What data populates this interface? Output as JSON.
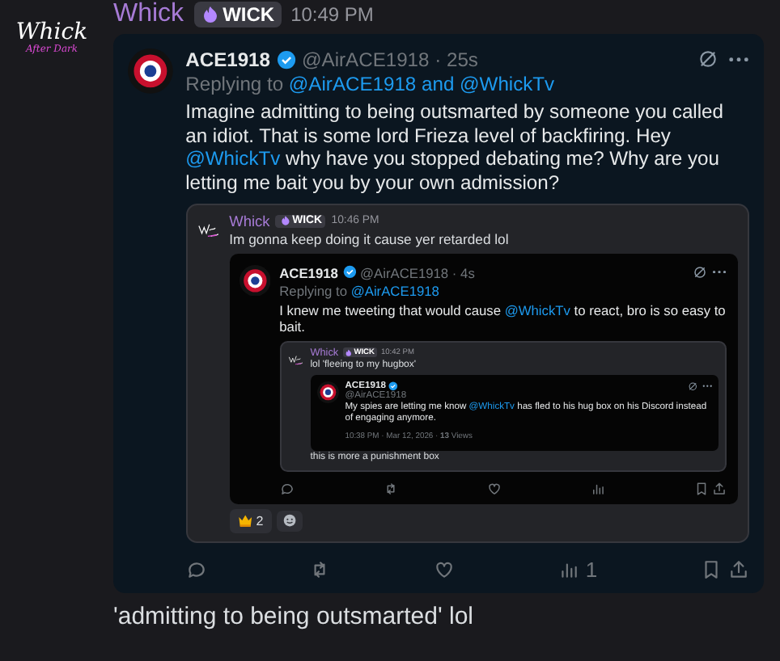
{
  "message": {
    "author": "Whick",
    "badge": "WICK",
    "time": "10:49 PM",
    "avatar_text": [
      "Whick",
      "After Dark"
    ],
    "tweet": {
      "name": "ACE1918",
      "handle": "@AirACE1918",
      "time": "· 25s",
      "has_actions": true,
      "views": "1",
      "replying": [
        {
          "text": "Replying to",
          "kind": "plain"
        },
        {
          "text": "@AirACE1918",
          "kind": "mention"
        },
        {
          "text": "and",
          "kind": "mention"
        },
        {
          "text": "@WhickTv",
          "kind": "mention"
        }
      ],
      "body": [
        {
          "text": "Imagine admitting to being outsmarted by someone you called an idiot. That is some lord Frieza level of backfiring. Hey ",
          "kind": "plain"
        },
        {
          "text": "@WhickTv",
          "kind": "mention"
        },
        {
          "text": " why have you stopped debating me?  Why are you letting me bait you by your own admission?",
          "kind": "plain"
        }
      ],
      "quote": {
        "author": "Whick",
        "badge": "WICK",
        "time": "10:46 PM",
        "text": "Im gonna keep doing it cause yer retarded lol",
        "tweet": {
          "name": "ACE1918",
          "handle": "@AirACE1918",
          "time": "· 4s",
          "has_actions": true,
          "replying": [
            {
              "text": "Replying to",
              "kind": "plain"
            },
            {
              "text": "@AirACE1918",
              "kind": "mention"
            }
          ],
          "body": [
            {
              "text": "I knew me tweeting that would cause ",
              "kind": "plain"
            },
            {
              "text": "@WhickTv",
              "kind": "mention"
            },
            {
              "text": " to react, bro is so easy to bait.",
              "kind": "plain"
            }
          ],
          "quote": {
            "author": "Whick",
            "badge": "WICK",
            "time": "10:42 PM",
            "text": "lol 'fleeing to my hugbox'",
            "tweet": {
              "name": "ACE1918",
              "handle": "@AirACE1918",
              "has_actions": false,
              "body": [
                {
                  "text": "My spies are letting me know ",
                  "kind": "plain"
                },
                {
                  "text": "@WhickTv",
                  "kind": "mention"
                },
                {
                  "text": " has fled to his hug box on his Discord instead of engaging anymore.",
                  "kind": "plain"
                }
              ],
              "footer": "10:38 PM · Mar 12, 2026 · **13** Views"
            },
            "followup": "this is more a punishment box"
          }
        },
        "reactions": [
          {
            "count": "2",
            "selected": false
          }
        ]
      }
    }
  },
  "reply_text": "'admitting to being outsmarted' lol"
}
